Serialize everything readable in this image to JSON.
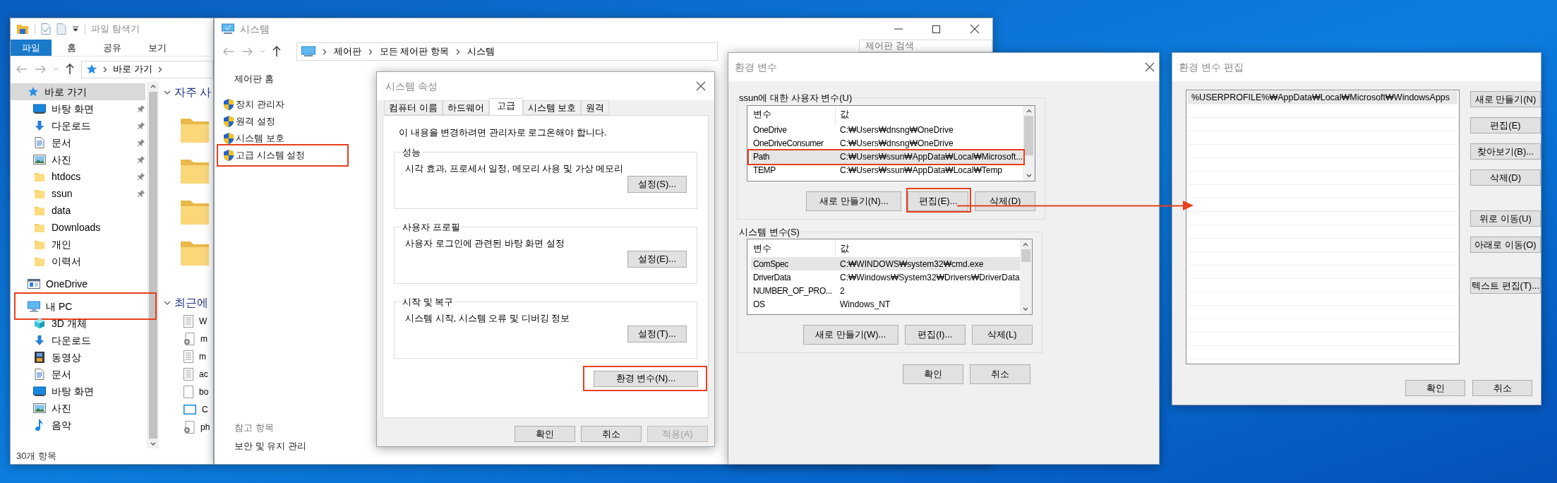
{
  "explorer": {
    "title": "파일 탐색기",
    "ribbon_tabs": [
      {
        "label": "파일",
        "selected": true
      },
      {
        "label": "홈",
        "selected": false
      },
      {
        "label": "공유",
        "selected": false
      },
      {
        "label": "보기",
        "selected": false
      }
    ],
    "breadcrumb": [
      "바로 가기"
    ],
    "nav": [
      {
        "label": "바로 가기",
        "kind": "star",
        "selected": true,
        "highlighted": false,
        "children": [
          {
            "label": "바탕 화면",
            "kind": "desktop",
            "pinned": true
          },
          {
            "label": "다운로드",
            "kind": "download",
            "pinned": true
          },
          {
            "label": "문서",
            "kind": "document",
            "pinned": true
          },
          {
            "label": "사진",
            "kind": "picture",
            "pinned": true
          },
          {
            "label": "htdocs",
            "kind": "folder",
            "pinned": true
          },
          {
            "label": "ssun",
            "kind": "folder",
            "pinned": true
          },
          {
            "label": "data",
            "kind": "folder",
            "pinned": false
          },
          {
            "label": "Downloads",
            "kind": "folder",
            "pinned": false
          },
          {
            "label": "개인",
            "kind": "folder",
            "pinned": false
          },
          {
            "label": "이력서",
            "kind": "folder",
            "pinned": false
          }
        ]
      },
      {
        "label": "OneDrive",
        "kind": "drive",
        "selected": false,
        "highlighted": false
      },
      {
        "label": "내 PC",
        "kind": "pc",
        "selected": false,
        "highlighted": true,
        "children": [
          {
            "label": "3D 개체",
            "kind": "cube",
            "pinned": false
          },
          {
            "label": "다운로드",
            "kind": "download",
            "pinned": false
          },
          {
            "label": "동영상",
            "kind": "video",
            "pinned": false
          },
          {
            "label": "문서",
            "kind": "document",
            "pinned": false
          },
          {
            "label": "바탕 화면",
            "kind": "desktop",
            "pinned": false
          },
          {
            "label": "사진",
            "kind": "picture",
            "pinned": false
          },
          {
            "label": "음악",
            "kind": "music",
            "pinned": false
          }
        ]
      }
    ],
    "frequent_title": "자주 사",
    "recent_title": "최근에",
    "recent_items": [
      {
        "label": "W",
        "kind": "text"
      },
      {
        "label": "m",
        "kind": "settings"
      },
      {
        "label": "m",
        "kind": "text"
      },
      {
        "label": "ac",
        "kind": "text"
      },
      {
        "label": "bo",
        "kind": "blank"
      },
      {
        "label": "C",
        "kind": "screen"
      },
      {
        "label": "ph",
        "kind": "settings"
      }
    ],
    "status": "30개 항목"
  },
  "system_window": {
    "title": "시스템",
    "breadcrumb": [
      "제어판",
      "모든 제어판 항목",
      "시스템"
    ],
    "search_placeholder": "제어판 검색",
    "home_link": "제어판 홈",
    "tasks": [
      {
        "label": "장치 관리자",
        "highlighted": false
      },
      {
        "label": "원격 설정",
        "highlighted": false
      },
      {
        "label": "시스템 보호",
        "highlighted": false
      },
      {
        "label": "고급 시스템 설정",
        "highlighted": true
      }
    ],
    "see_also_title": "참고 항목",
    "see_also": [
      "보안 및 유지 관리"
    ]
  },
  "system_properties": {
    "title": "시스템 속성",
    "tabs": [
      {
        "label": "컴퓨터 이름",
        "selected": false
      },
      {
        "label": "하드웨어",
        "selected": false
      },
      {
        "label": "고급",
        "selected": true
      },
      {
        "label": "시스템 보호",
        "selected": false
      },
      {
        "label": "원격",
        "selected": false
      }
    ],
    "notice": "이 내용을 변경하려면 관리자로 로그온해야 합니다.",
    "groups": [
      {
        "title": "성능",
        "description": "시각 효과, 프로세서 일정, 메모리 사용 및 가상 메모리",
        "button": "설정(S)..."
      },
      {
        "title": "사용자 프로필",
        "description": "사용자 로그인에 관련된 바탕 화면 설정",
        "button": "설정(E)..."
      },
      {
        "title": "시작 및 복구",
        "description": "시스템 시작, 시스템 오류 및 디버깅 정보",
        "button": "설정(T)..."
      }
    ],
    "env_button": {
      "label": "환경 변수(N)...",
      "highlighted": true
    },
    "buttons": [
      {
        "label": "확인",
        "disabled": false
      },
      {
        "label": "취소",
        "disabled": false
      },
      {
        "label": "적용(A)",
        "disabled": true
      }
    ]
  },
  "environment_variables": {
    "title": "환경 변수",
    "sections": [
      {
        "title": "ssun에 대한 사용자 변수(U)",
        "columns": [
          "변수",
          "값"
        ],
        "rows": [
          {
            "name": "OneDrive",
            "value": "C:₩Users₩dnsng₩OneDrive",
            "selected": false,
            "highlighted": false
          },
          {
            "name": "OneDriveConsumer",
            "value": "C:₩Users₩dnsng₩OneDrive",
            "selected": false,
            "highlighted": false
          },
          {
            "name": "Path",
            "value": "C:₩Users₩ssun₩AppData₩Local₩Microsoft...",
            "selected": true,
            "highlighted": true
          },
          {
            "name": "TEMP",
            "value": "C:₩Users₩ssun₩AppData₩Local₩Temp",
            "selected": false,
            "highlighted": false
          }
        ],
        "buttons": [
          {
            "label": "새로 만들기(N)...",
            "highlighted": false
          },
          {
            "label": "편집(E)...",
            "highlighted": true
          },
          {
            "label": "삭제(D)",
            "highlighted": false
          }
        ]
      },
      {
        "title": "시스템 변수(S)",
        "columns": [
          "변수",
          "값"
        ],
        "rows": [
          {
            "name": "ComSpec",
            "value": "C:₩WINDOWS₩system32₩cmd.exe",
            "selected": true,
            "highlighted": false
          },
          {
            "name": "DriverData",
            "value": "C:₩Windows₩System32₩Drivers₩DriverData",
            "selected": false,
            "highlighted": false
          },
          {
            "name": "NUMBER_OF_PRO...",
            "value": "2",
            "selected": false,
            "highlighted": false
          },
          {
            "name": "OS",
            "value": "Windows_NT",
            "selected": false,
            "highlighted": false
          }
        ],
        "buttons": [
          {
            "label": "새로 만들기(W)...",
            "highlighted": false
          },
          {
            "label": "편집(I)...",
            "highlighted": false
          },
          {
            "label": "삭제(L)",
            "highlighted": false
          }
        ]
      }
    ],
    "buttons": [
      "확인",
      "취소"
    ]
  },
  "edit_variable": {
    "title": "환경 변수 편집",
    "entries": [
      {
        "value": "%USERPROFILE%₩AppData₩Local₩Microsoft₩WindowsApps",
        "selected": true
      }
    ],
    "button_groups": [
      [
        "새로 만들기(N)",
        "편집(E)",
        "찾아보기(B)...",
        "삭제(D)"
      ],
      [
        "위로 이동(U)",
        "아래로 이동(O)"
      ],
      [
        "텍스트 편집(T)..."
      ]
    ],
    "buttons": [
      "확인",
      "취소"
    ]
  }
}
